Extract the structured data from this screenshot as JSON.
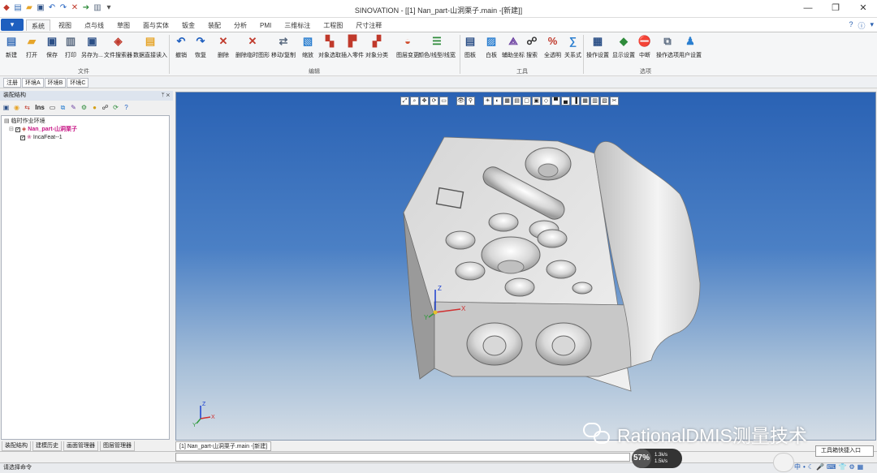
{
  "window": {
    "title": "SINOVATION - [[1] Nan_part-山洞栗子.main -[新建]]",
    "quick_access_icons": [
      "app-logo-icon",
      "new-icon",
      "open-icon",
      "save-icon",
      "undo-icon",
      "redo-icon",
      "delete-icon",
      "arrow-icon",
      "print-icon",
      "dropdown-icon"
    ],
    "controls": [
      "minimize-icon",
      "restore-icon",
      "close-icon"
    ]
  },
  "ribbon_tabs": {
    "file_button": "▾",
    "tabs": [
      "系统",
      "视图",
      "点与线",
      "草图",
      "面与实体",
      "钣金",
      "装配",
      "分析",
      "PMI",
      "三维标注",
      "工程图",
      "尺寸注释"
    ],
    "active": "系统",
    "right_icons": [
      "help-icon",
      "info-icon",
      "options-icon"
    ]
  },
  "ribbon": {
    "buttons": [
      {
        "label": "新建",
        "icon": "new-file-icon",
        "color": "#3a6fb7",
        "glyph": "▤"
      },
      {
        "label": "打开",
        "icon": "open-folder-icon",
        "color": "#e6a52a",
        "glyph": "▰"
      },
      {
        "label": "保存",
        "icon": "save-icon",
        "color": "#2b4f86",
        "glyph": "▣"
      },
      {
        "label": "打印",
        "icon": "print-icon",
        "color": "#5a6a80",
        "glyph": "▥"
      },
      {
        "label": "另存为...",
        "icon": "save-as-icon",
        "color": "#2b4f86",
        "glyph": "▣"
      },
      {
        "label": "文件搜索器",
        "icon": "file-search-icon",
        "color": "#c0392b",
        "glyph": "◈"
      },
      {
        "label": "数据直接读入",
        "icon": "data-import-icon",
        "color": "#e6a52a",
        "glyph": "▤"
      },
      {
        "label": "撤销",
        "icon": "undo-icon",
        "color": "#1f5fbf",
        "glyph": "↶"
      },
      {
        "label": "恢复",
        "icon": "redo-icon",
        "color": "#1f5fbf",
        "glyph": "↷"
      },
      {
        "label": "删除",
        "icon": "delete-icon",
        "color": "#c0392b",
        "glyph": "✕"
      },
      {
        "label": "删除临时图形",
        "icon": "delete-temp-icon",
        "color": "#c0392b",
        "glyph": "✕"
      },
      {
        "label": "移动/复制",
        "icon": "move-copy-icon",
        "color": "#5a6a80",
        "glyph": "⇄"
      },
      {
        "label": "缩放",
        "icon": "scale-icon",
        "color": "#2b7fd0",
        "glyph": "▧"
      },
      {
        "label": "对象选取",
        "icon": "object-select-icon",
        "color": "#c0392b",
        "glyph": "▚"
      },
      {
        "label": "插入零件",
        "icon": "insert-part-icon",
        "color": "#c0392b",
        "glyph": "▛"
      },
      {
        "label": "对象分类",
        "icon": "object-classify-icon",
        "color": "#c0392b",
        "glyph": "▞"
      },
      {
        "label": "图层变更",
        "icon": "layer-change-icon",
        "color": "#d04a2a",
        "glyph": "◒"
      },
      {
        "label": "颜色/线型/线宽",
        "icon": "color-linetype-icon",
        "color": "#2e8b3a",
        "glyph": "☰"
      },
      {
        "label": "图板",
        "icon": "drawing-board-icon",
        "color": "#2b4f86",
        "glyph": "▤"
      },
      {
        "label": "白板",
        "icon": "whiteboard-icon",
        "color": "#2b7fd0",
        "glyph": "▨"
      },
      {
        "label": "辅助坐标",
        "icon": "aux-coordinate-icon",
        "color": "#6b3fa0",
        "glyph": "⟁"
      },
      {
        "label": "搜索",
        "icon": "binoculars-icon",
        "color": "#333333",
        "glyph": "☍"
      },
      {
        "label": "全透明",
        "icon": "transparent-icon",
        "color": "#c0392b",
        "glyph": "%"
      },
      {
        "label": "关系式",
        "icon": "relation-icon",
        "color": "#2b7fd0",
        "glyph": "∑"
      },
      {
        "label": "操作设置",
        "icon": "operation-settings-icon",
        "color": "#2b4f86",
        "glyph": "▦"
      },
      {
        "label": "显示设置",
        "icon": "display-settings-icon",
        "color": "#2e8b3a",
        "glyph": "◆"
      },
      {
        "label": "中断",
        "icon": "stop-icon",
        "color": "#c0392b",
        "glyph": "⛔"
      },
      {
        "label": "操作选项",
        "icon": "operation-options-icon",
        "color": "#5a6a80",
        "glyph": "⧉"
      },
      {
        "label": "用户设置",
        "icon": "user-settings-icon",
        "color": "#2b7fd0",
        "glyph": "♟"
      }
    ],
    "groups": [
      {
        "label": "文件"
      },
      {
        "label": "编辑"
      },
      {
        "label": "工具"
      },
      {
        "label": "选项"
      }
    ]
  },
  "environment_tabs": [
    "注册",
    "环境A",
    "环境B",
    "环境C"
  ],
  "assembly_panel": {
    "title": "装配结构",
    "pin": "ᛘ ✕",
    "toolbar_icons": [
      "save-icon",
      "assembly-icon",
      "link-icon",
      "ins-icon",
      "frame-icon",
      "copy-icon",
      "palette-icon",
      "settings-icon",
      "yellow-icon",
      "binoculars-icon",
      "refresh-icon",
      "help-icon"
    ],
    "ins_label": "Ins",
    "tree": [
      {
        "label": "临时作业环境",
        "icon": "workspace-icon"
      },
      {
        "label": "Nan_part-山洞栗子",
        "icon": "part-icon",
        "checked": true
      },
      {
        "label": "IncaFeat--1",
        "icon": "feature-icon",
        "checked": true
      }
    ]
  },
  "bottom_tabs": [
    "装配结构",
    "建模历史",
    "画面管理器",
    "图层管理器"
  ],
  "document_tab": "[1] Nan_part-山洞栗子.main -[新建]",
  "viewport": {
    "toolbar_icons": [
      "fit-icon",
      "zoom-icon",
      "pan-icon",
      "rotate-icon",
      "area-zoom-icon",
      "eye-icon",
      "search-icon",
      "light-icon",
      "shade-icon",
      "wire-icon",
      "hidden-icon",
      "box-icon",
      "cube-icon",
      "view-iso-icon",
      "view-top-icon",
      "view-front-icon",
      "view-right-icon",
      "grid-icon",
      "ruler-icon",
      "section-icon",
      "clip-icon"
    ],
    "axis_labels": {
      "x": "X",
      "y": "Y",
      "z": "Z"
    },
    "background_top": "#2a62b4",
    "background_bottom": "#d4dde6"
  },
  "status": {
    "text": "请选择命令"
  },
  "watermark": {
    "text": "RationalDMIS测量技术"
  },
  "system_overlay": {
    "speed_percent": "57%",
    "upload": "1.3k/s",
    "download": "1.5k/s",
    "tray_popup": "工具箱快捷入口",
    "tray_icons": [
      "中",
      "•",
      "☾",
      "🎤",
      "⌨",
      "👕",
      "⚙",
      "▦"
    ]
  }
}
